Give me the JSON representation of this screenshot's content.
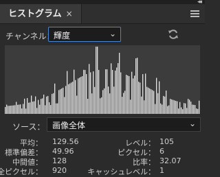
{
  "panel": {
    "tab_title": "ヒストグラム",
    "tab_close": "×"
  },
  "channel": {
    "label": "チャンネル：",
    "value": "輝度"
  },
  "source": {
    "label": "ソース：",
    "value": "画像全体"
  },
  "stats": {
    "mean_label": "平均：",
    "mean": "129.56",
    "stddev_label": "標準偏差：",
    "stddev": "49.96",
    "median_label": "中間値：",
    "median": "128",
    "pixels_label": "全ピクセル：",
    "pixels": "920",
    "level_label": "レベル：",
    "level": "105",
    "count_label": "ピクセル：",
    "count": "6",
    "percentile_label": "比率：",
    "percentile": "32.07",
    "cache_label": "キャッシュレベル：",
    "cache": "1"
  },
  "colors": {
    "histogram_fill": "#e6e6e6",
    "histogram_bg": "#3c3c3c",
    "focus_border": "#4a86d6"
  }
}
